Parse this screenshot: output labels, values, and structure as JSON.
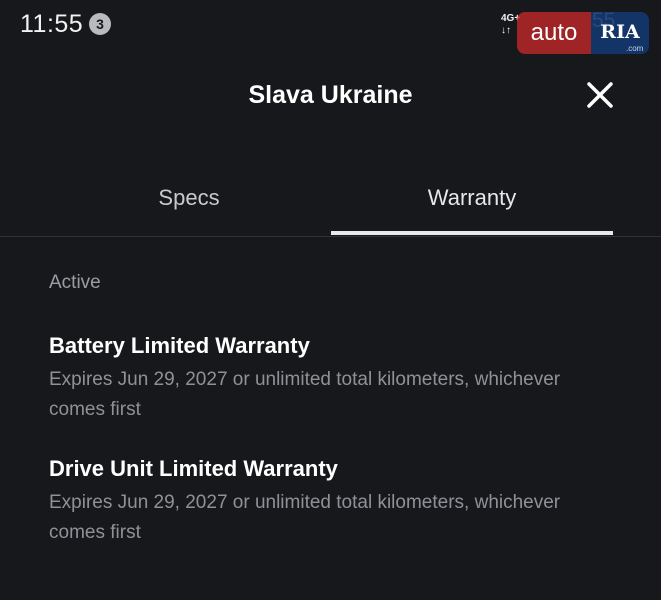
{
  "status_bar": {
    "time": "11:55",
    "notification_count": "3",
    "network_label": "4G+",
    "network_arrows": "↓↑",
    "battery_percent": "55"
  },
  "watermark": {
    "auto_text": "auto",
    "ria_text": "RIA",
    "domain_text": ".com"
  },
  "header": {
    "title": "Slava Ukraine",
    "close_icon": "close-icon"
  },
  "tabs": [
    {
      "label": "Specs",
      "active": false
    },
    {
      "label": "Warranty",
      "active": true
    }
  ],
  "warranty": {
    "section_label": "Active",
    "items": [
      {
        "title": "Battery Limited Warranty",
        "description": "Expires Jun 29, 2027 or unlimited total kilometers, whichever comes first"
      },
      {
        "title": "Drive Unit Limited Warranty",
        "description": "Expires Jun 29, 2027 or unlimited total kilometers, whichever comes first"
      }
    ]
  },
  "colors": {
    "background": "#17181b",
    "primary_text": "#ffffff",
    "secondary_text": "#8f9196",
    "tab_indicator": "#e8e8e8"
  }
}
